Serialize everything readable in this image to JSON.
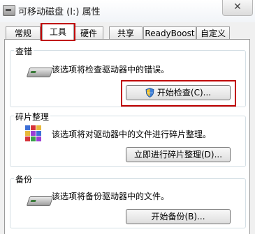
{
  "window": {
    "title": "可移动磁盘 (I:) 属性",
    "close_glyph": "✕"
  },
  "tabs": [
    {
      "label": "常规"
    },
    {
      "label": "工具",
      "active": true
    },
    {
      "label": "硬件"
    },
    {
      "label": "共享"
    },
    {
      "label": "ReadyBoost"
    },
    {
      "label": "自定义"
    }
  ],
  "sections": {
    "error_check": {
      "title": "查错",
      "description": "该选项将检查驱动器中的错误。",
      "button_label": "开始检查(C)...",
      "icon": "drive-icon"
    },
    "defrag": {
      "title": "碎片整理",
      "description": "该选项将对驱动器中的文件进行碎片整理。",
      "button_label": "立即进行碎片整理(D)...",
      "icon": "defrag-icon"
    },
    "backup": {
      "title": "备份",
      "description": "该选项将备份驱动器中的文件。",
      "button_label": "开始备份(B)...",
      "icon": "backup-drive-icon"
    }
  },
  "highlight_color": "#c00000"
}
